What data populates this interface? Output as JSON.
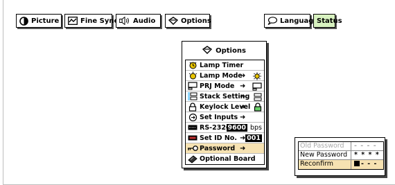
{
  "tabs": [
    {
      "label": "Picture",
      "icon": "picture-icon"
    },
    {
      "label": "Fine Sync",
      "icon": "fine-sync-icon"
    },
    {
      "label": "Audio",
      "icon": "speaker-icon"
    },
    {
      "label": "Options",
      "icon": "options-icon"
    },
    {
      "label": "Language",
      "icon": "speech-bubble-icon"
    },
    {
      "label": "Status"
    }
  ],
  "options_menu": {
    "title": "Options",
    "items": [
      {
        "label": "Lamp Timer",
        "icon": "lamp-timer-icon"
      },
      {
        "label": "Lamp Mode",
        "icon": "lamp-mode-icon",
        "arrow": "➜"
      },
      {
        "label": "PRJ Mode",
        "icon": "projector-icon",
        "arrow": "➜"
      },
      {
        "label": "Stack Setting",
        "icon": "stack-icon",
        "arrow": "➜"
      },
      {
        "label": "Keylock Level",
        "icon": "lock-icon",
        "arrow": "➜"
      },
      {
        "label": "Set Inputs",
        "icon": "set-inputs-icon",
        "arrow": "➜"
      },
      {
        "label": "RS-232C",
        "icon": "rs232c-icon",
        "arrow": "➜",
        "value": "9600",
        "unit": "bps"
      },
      {
        "label": "Set ID No.",
        "icon": "id-icon",
        "arrow": "➜",
        "value": "001"
      },
      {
        "label": "Password",
        "icon": "key-icon",
        "arrow": "➜"
      },
      {
        "label": "Optional Board",
        "icon": "board-icon"
      }
    ]
  },
  "password_dialog": {
    "rows": [
      {
        "label": "Old Password",
        "value": "- - - -"
      },
      {
        "label": "New Password",
        "value": "* * * *"
      },
      {
        "label": "Reconfirm",
        "value": "- - -"
      }
    ]
  },
  "colors": {
    "selected_row": "#f6e2b2",
    "status_tab": "#d8f2c0",
    "icon_yellow": "#d4b000"
  }
}
